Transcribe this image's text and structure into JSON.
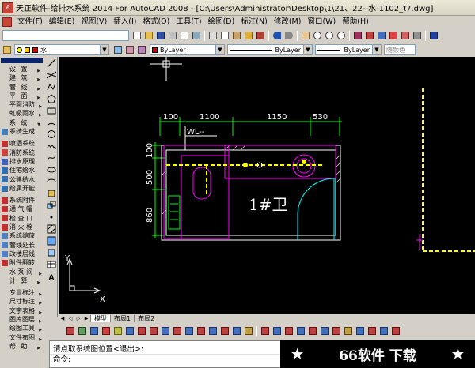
{
  "window": {
    "title": "天正软件-给排水系统 2014 For AutoCAD 2008 - [C:\\Users\\Administrator\\Desktop\\1\\21、22--水-1102_t7.dwg]"
  },
  "menubar": {
    "items": [
      "文件(F)",
      "编辑(E)",
      "视图(V)",
      "插入(I)",
      "格式(O)",
      "工具(T)",
      "绘图(D)",
      "标注(N)",
      "修改(M)",
      "窗口(W)",
      "帮助(H)"
    ]
  },
  "layer_toolbar": {
    "layer_name": "水",
    "color_value": "ByLayer",
    "linetype_value": "ByLayer",
    "lineweight_value": "ByLayer",
    "plot_style_value": "随颜色"
  },
  "sidebar": {
    "items": [
      {
        "label": "设    置",
        "arrow": true
      },
      {
        "label": "建    筑",
        "arrow": true
      },
      {
        "label": "管    线",
        "arrow": true
      },
      {
        "label": "平    面",
        "arrow": true
      },
      {
        "label": "平面消防",
        "arrow": true
      },
      {
        "label": "虹吸雨水",
        "arrow": true
      },
      {
        "label": "系    统",
        "arrow": true
      }
    ],
    "system_items": [
      {
        "label": "系统生成",
        "icon": "system-generate-icon"
      },
      {
        "label": "喷洒系统",
        "icon": "sprinkler-system-icon"
      },
      {
        "label": "消防系统",
        "icon": "fire-system-icon"
      },
      {
        "label": "排水原理",
        "icon": "drainage-principle-icon"
      },
      {
        "label": "住宅给水",
        "icon": "residential-supply-icon"
      },
      {
        "label": "公建给水",
        "icon": "public-supply-icon"
      },
      {
        "label": "给属开能",
        "icon": "supply-open-icon"
      }
    ],
    "system_parts": [
      {
        "label": "系统附件",
        "icon": "system-fitting-icon"
      },
      {
        "label": "通 气 帽",
        "icon": "vent-cap-icon"
      },
      {
        "label": "检 查 口",
        "icon": "inspection-port-icon"
      },
      {
        "label": "消 火 栓",
        "icon": "hydrant-icon"
      },
      {
        "label": "系统缩放",
        "icon": "system-zoom-icon"
      },
      {
        "label": "管线延长",
        "icon": "pipe-extend-icon"
      },
      {
        "label": "改楼层线",
        "icon": "floor-line-icon"
      },
      {
        "label": "附件翻转",
        "icon": "fitting-flip-icon"
      }
    ],
    "tail_items": [
      {
        "label": "水 泵 间",
        "arrow": true
      },
      {
        "label": "计    算",
        "arrow": true
      },
      {
        "label": "专业标注",
        "arrow": true
      },
      {
        "label": "尺寸标注",
        "arrow": true
      },
      {
        "label": "文字表格",
        "arrow": true
      },
      {
        "label": "图库图层",
        "arrow": true
      },
      {
        "label": "绘图工具",
        "arrow": true
      },
      {
        "label": "文件布图",
        "arrow": true
      },
      {
        "label": "帮    助",
        "arrow": true
      }
    ]
  },
  "drawing": {
    "dims": [
      "100",
      "1100",
      "1150",
      "530"
    ],
    "vdims": [
      "100",
      "500",
      "860"
    ],
    "pipe_tag": "WL--",
    "room_label": "1#卫",
    "colors": {
      "wall": "#ffffff",
      "dims": "#00ff00",
      "pipe": "#ffff00",
      "fixture": "#ff00ff",
      "door": "#00ffff"
    }
  },
  "ucs": {
    "x_label": "X",
    "y_label": "Y"
  },
  "layout_tabs": [
    "模型",
    "布局1",
    "布局2"
  ],
  "command": {
    "line1": "请点取系统图位置<退出>:",
    "line2": "命令:"
  },
  "watermark": {
    "left_star": "★",
    "text": "66软件 下载",
    "right_star": "★"
  }
}
